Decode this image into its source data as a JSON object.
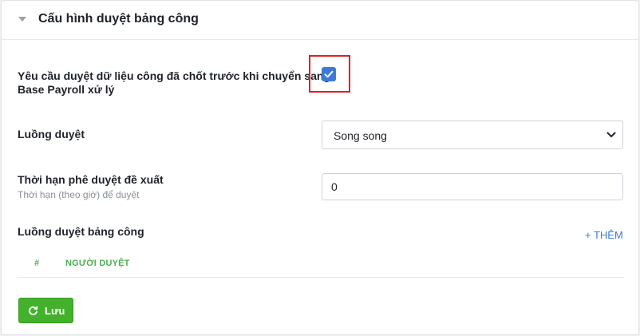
{
  "panel": {
    "title": "Cấu hình duyệt bảng công",
    "collapse_icon": "caret-down-icon"
  },
  "require_approval": {
    "label_line1": "Yêu cầu duyệt dữ liệu công đã chốt trước khi chuyển sang",
    "label_line2": "Base Payroll xử lý",
    "checked": true
  },
  "approval_flow": {
    "label": "Luồng duyệt",
    "selected": "Song song"
  },
  "deadline": {
    "label": "Thời hạn phê duyệt đề xuất",
    "hint": "Thời hạn (theo giờ) để duyệt",
    "value": "0"
  },
  "timesheet_flow": {
    "label": "Luồng duyệt bảng công",
    "add_label": "+ THÊM",
    "columns": [
      "#",
      "NGƯỜI DUYỆT"
    ]
  },
  "save": {
    "label": "Lưu",
    "icon": "refresh-icon"
  },
  "colors": {
    "accent": "#3a7bd5",
    "save_green": "#43b12b",
    "highlight_red": "#e02020",
    "column_header_green": "#4caf50"
  }
}
